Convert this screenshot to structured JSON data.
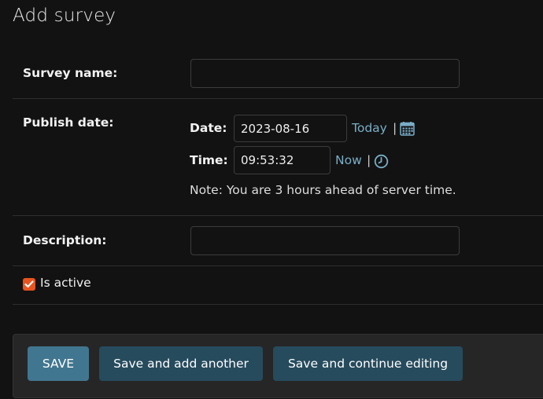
{
  "page": {
    "title": "Add survey"
  },
  "fields": {
    "survey_name": {
      "label": "Survey name:",
      "value": ""
    },
    "publish_date": {
      "label": "Publish date:",
      "date_label": "Date:",
      "date_value": "2023-08-16",
      "today_link": "Today",
      "separator": "|",
      "time_label": "Time:",
      "time_value": "09:53:32",
      "now_link": "Now",
      "note": "Note: You are 3 hours ahead of server time."
    },
    "description": {
      "label": "Description:",
      "value": ""
    },
    "is_active": {
      "label": "Is active",
      "checked": true
    }
  },
  "actions": {
    "save": "SAVE",
    "save_add_another": "Save and add another",
    "save_continue": "Save and continue editing"
  },
  "icons": {
    "calendar": "calendar-icon",
    "clock": "clock-icon"
  },
  "colors": {
    "background": "#121212",
    "link": "#79aec8",
    "primary_button": "#417690",
    "secondary_button": "#264b5d",
    "checkbox": "#e8541f"
  }
}
